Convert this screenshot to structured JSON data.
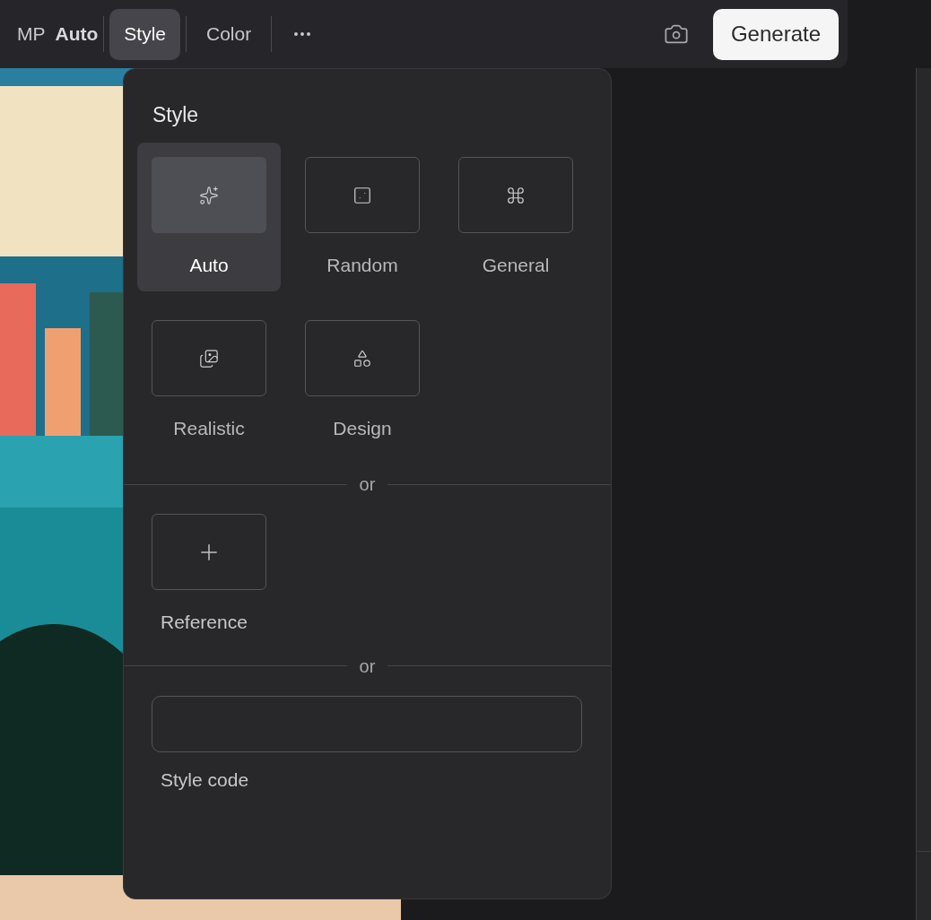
{
  "toolbar": {
    "mp_label": "MP",
    "mp_value": "Auto",
    "tabs": [
      {
        "label": "Style",
        "selected": true
      },
      {
        "label": "Color",
        "selected": false
      }
    ],
    "generate": "Generate"
  },
  "style_panel": {
    "title": "Style",
    "styles": [
      {
        "label": "Auto",
        "kind": "sparkles",
        "selected": true
      },
      {
        "label": "Random",
        "kind": "dice",
        "selected": false
      },
      {
        "label": "General",
        "kind": "command",
        "selected": false
      },
      {
        "label": "Realistic",
        "kind": "photos",
        "selected": false
      },
      {
        "label": "Design",
        "kind": "shapes",
        "selected": false
      }
    ],
    "divider_1": "or",
    "reference": "Reference",
    "divider_2": "or",
    "style_code": {
      "label": "Style code"
    }
  }
}
